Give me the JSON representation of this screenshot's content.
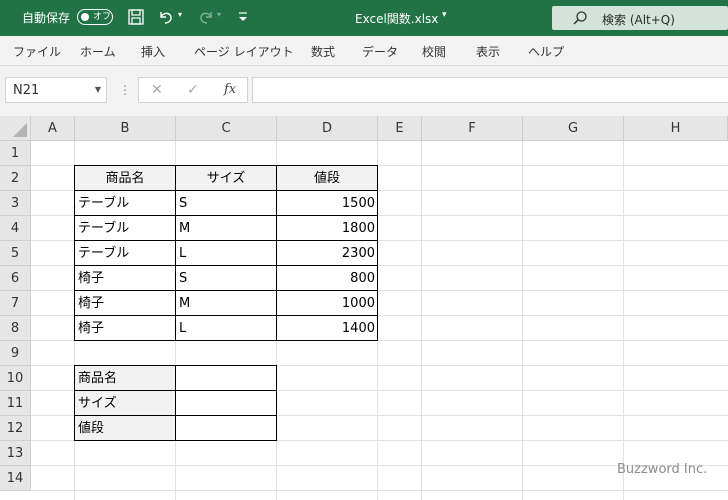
{
  "title_bar": {
    "autosave_label": "自動保存",
    "autosave_state": "オフ",
    "filename": "Excel関数.xlsx",
    "filename_caret": "▾",
    "search_placeholder": "検索 (Alt+Q)",
    "qat_icons": [
      "save-icon",
      "undo-icon",
      "redo-icon",
      "customize-qat-icon"
    ]
  },
  "menu": [
    "ファイル",
    "ホーム",
    "挿入",
    "ページ レイアウト",
    "数式",
    "データ",
    "校閲",
    "表示",
    "ヘルプ"
  ],
  "formula_bar": {
    "name_box": "N21",
    "cancel": "✕",
    "enter": "✓",
    "fx": "fx",
    "content": ""
  },
  "grid": {
    "columns": [
      "A",
      "B",
      "C",
      "D",
      "E",
      "F",
      "G",
      "H"
    ],
    "rows": [
      "1",
      "2",
      "3",
      "4",
      "5",
      "6",
      "7",
      "8",
      "9",
      "10",
      "11",
      "12",
      "13",
      "14"
    ]
  },
  "table": {
    "headers": [
      "商品名",
      "サイズ",
      "値段"
    ],
    "rows": [
      [
        "テーブル",
        "S",
        "1500"
      ],
      [
        "テーブル",
        "M",
        "1800"
      ],
      [
        "テーブル",
        "L",
        "2300"
      ],
      [
        "椅子",
        "S",
        "800"
      ],
      [
        "椅子",
        "M",
        "1000"
      ],
      [
        "椅子",
        "L",
        "1400"
      ]
    ]
  },
  "lookup": {
    "labels": [
      "商品名",
      "サイズ",
      "値段"
    ],
    "values": [
      "",
      "",
      ""
    ]
  },
  "watermark": "Buzzword Inc.",
  "colors": {
    "titlebar": "#217346",
    "ribbon": "#f3f3f3",
    "header_fill": "#f2f2f2",
    "gridline": "#e1e1e1"
  }
}
